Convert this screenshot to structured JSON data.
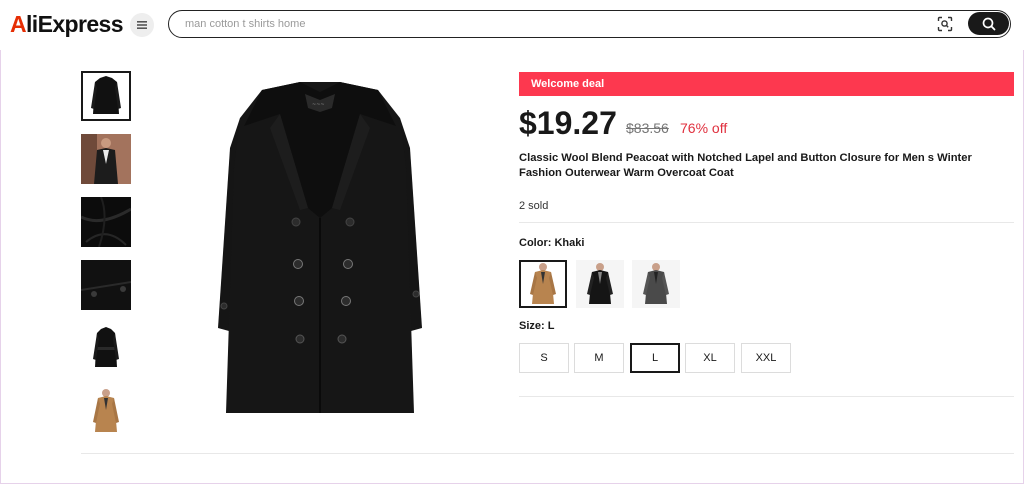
{
  "header": {
    "logo_text": "AliExpress",
    "search_placeholder": "man cotton t shirts home"
  },
  "gallery": {
    "thumbnails": [
      "black-coat-front",
      "coat-on-model",
      "fabric-closeup",
      "button-closeup",
      "coat-with-belt",
      "khaki-coat-model"
    ],
    "selected_index": 0
  },
  "product": {
    "deal_banner": "Welcome deal",
    "price": "$19.27",
    "original_price": "$83.56",
    "discount": "76% off",
    "title": "Classic Wool Blend Peacoat with Notched Lapel and Button Closure for Men s Winter Fashion Outerwear Warm Overcoat Coat",
    "sold": "2 sold",
    "color_label": "Color: Khaki",
    "colors": [
      "Khaki",
      "Black",
      "Gray"
    ],
    "selected_color": "Khaki",
    "size_label": "Size: L",
    "sizes": [
      "S",
      "M",
      "L",
      "XL",
      "XXL"
    ],
    "selected_size": "L"
  },
  "colors": {
    "deal_banner": "#fd384f",
    "discount": "#e0303e",
    "search_button": "#191919",
    "khaki": "#b8844f"
  },
  "icons": [
    "menu-icon",
    "camera-search-icon",
    "search-icon"
  ]
}
